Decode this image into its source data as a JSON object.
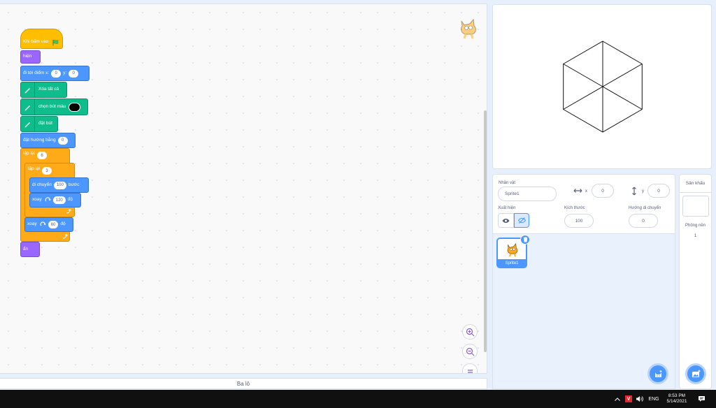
{
  "blocks": {
    "when_flag_clicked": "Khi bấm vào",
    "show": "hiện",
    "goto_label": "đi tới điểm x:",
    "goto_x": "0",
    "goto_y_label": "y:",
    "goto_y": "0",
    "erase_all": "Xóa tất cả",
    "set_pen_color": "chọn bút màu",
    "pen_down": "đặt bút",
    "point_in_direction": "đặt hướng bằng",
    "point_value": "0",
    "repeat_outer": "lặp lại",
    "repeat_outer_count": "6",
    "repeat_inner": "lặp lại",
    "repeat_inner_count": "3",
    "move_label": "di chuyển",
    "move_steps": "100",
    "move_unit": "bước",
    "turn_label": "xoay",
    "turn_inner_value": "120",
    "turn_unit": "độ",
    "turn_outer_value": "60",
    "hide": "ẩn"
  },
  "backpack_label": "Ba lô",
  "sprite_info": {
    "sprite_label": "Nhân vật",
    "sprite_name": "Sprite1",
    "x_label": "x",
    "x_value": "0",
    "y_label": "y",
    "y_value": "0",
    "show_label": "Xuất hiện",
    "size_label": "Kích thước",
    "size_value": "100",
    "direction_label": "Hướng di chuyển",
    "direction_value": "0"
  },
  "sprite_tile_name": "Sprite1",
  "stage_selector": {
    "title": "Sân khấu",
    "backdrops_label": "Phông nền",
    "backdrops_count": "1"
  },
  "taskbar": {
    "lang": "ENG",
    "time": "8:53 PM",
    "date": "5/14/2021",
    "antivirus_letter": "V"
  },
  "colors": {
    "events": "#ffbf00",
    "looks": "#9966ff",
    "motion": "#4c97ff",
    "pen": "#0fbd8c",
    "control": "#ffab19",
    "accent": "#4c97ff"
  },
  "icons": [
    "green-flag-icon",
    "pen-icon",
    "rotate-right-icon",
    "loop-arrow-icon",
    "zoom-in-icon",
    "zoom-out-icon",
    "zoom-reset-icon",
    "eye-icon",
    "eye-slash-icon",
    "trash-icon",
    "add-sprite-icon",
    "add-backdrop-icon",
    "chevron-up-icon",
    "speaker-icon",
    "notification-icon",
    "arrows-horizontal-icon",
    "arrows-vertical-icon",
    "scratch-cat-icon"
  ]
}
